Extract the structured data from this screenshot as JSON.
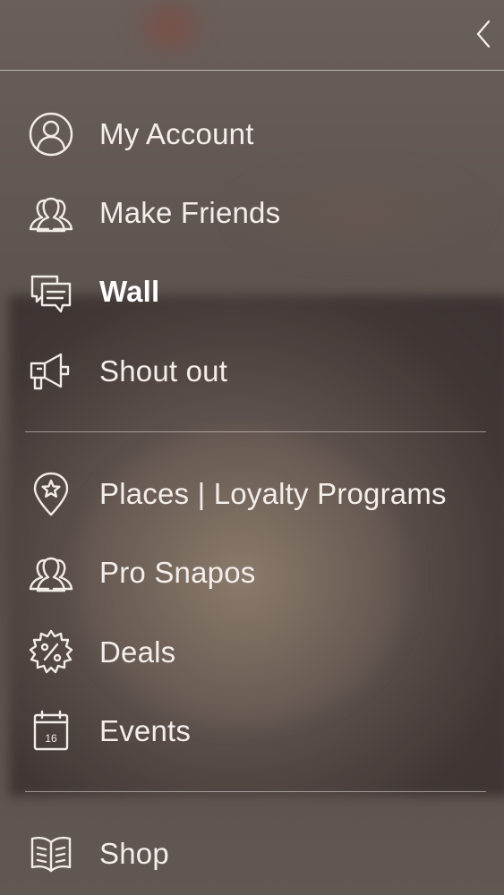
{
  "menu": {
    "primary": [
      {
        "label": "My Account",
        "icon": "user-circle-icon"
      },
      {
        "label": "Make Friends",
        "icon": "people-icon"
      },
      {
        "label": "Wall",
        "icon": "chat-bubbles-icon",
        "active": true
      },
      {
        "label": "Shout out",
        "icon": "megaphone-icon"
      }
    ],
    "secondary": [
      {
        "label": "Places | Loyalty Programs",
        "icon": "map-pin-star-icon"
      },
      {
        "label": "Pro Snapos",
        "icon": "people-icon"
      },
      {
        "label": "Deals",
        "icon": "discount-badge-icon"
      },
      {
        "label": "Events",
        "icon": "calendar-icon",
        "calendar_day": "16"
      }
    ],
    "tertiary": [
      {
        "label": "Shop",
        "icon": "open-book-icon"
      }
    ]
  },
  "topbar": {
    "back_icon": "chevron-left-icon"
  },
  "colors": {
    "text": "#f3eeeb",
    "divider": "rgba(255,255,255,0.5)",
    "backdrop": "#5a4f4b"
  }
}
